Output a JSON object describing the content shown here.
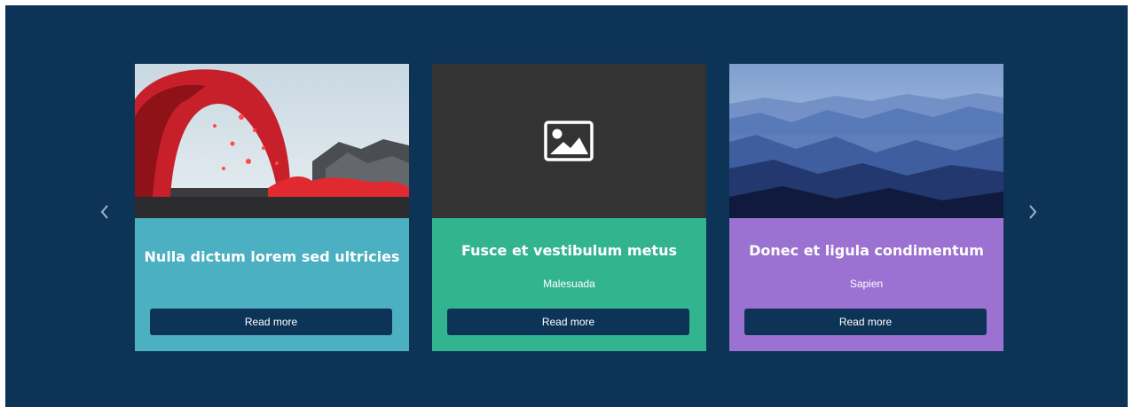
{
  "carousel": {
    "prev_icon": "chevron-left-icon",
    "next_icon": "chevron-right-icon",
    "cards": [
      {
        "title": "Nulla dictum lorem sed ultricies",
        "subtitle": "",
        "button_label": "Read more",
        "image": "volcano-lava-photo",
        "color": "#4bb0c1"
      },
      {
        "title": "Fusce et vestibulum metus",
        "subtitle": "Malesuada",
        "button_label": "Read more",
        "image": "image-placeholder-icon",
        "color": "#33b491"
      },
      {
        "title": "Donec et ligula condimentum",
        "subtitle": "Sapien",
        "button_label": "Read more",
        "image": "blue-mountains-photo",
        "color": "#9b71d1"
      }
    ]
  },
  "colors": {
    "background": "#0d3457",
    "placeholder_bg": "#333333"
  }
}
